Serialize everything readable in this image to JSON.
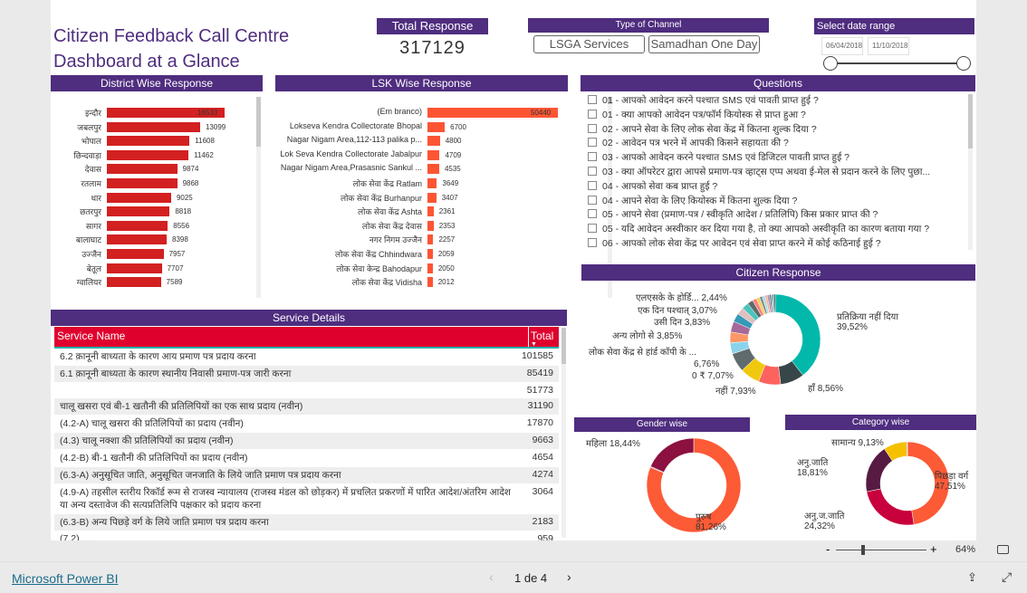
{
  "header": {
    "title_line1": "Citizen Feedback Call Centre",
    "title_line2": "Dashboard at a Glance",
    "total_label": "Total Response",
    "total_value": "317129",
    "channel_label": "Type of Channel",
    "channels": [
      "LSGA Services",
      "Samadhan One Day"
    ],
    "date_label": "Select date range",
    "date_from": "06/04/2018",
    "date_to": "11/10/2018",
    "date_range_fill": 1.0
  },
  "district": {
    "title": "District Wise Response",
    "color": "#d32020",
    "max": 16533,
    "items": [
      {
        "label": "इन्दौर",
        "value": 16533
      },
      {
        "label": "जबलपुर",
        "value": 13099
      },
      {
        "label": "भोपाल",
        "value": 11608
      },
      {
        "label": "छिन्दवाड़ा",
        "value": 11462
      },
      {
        "label": "देवास",
        "value": 9874
      },
      {
        "label": "रतलाम",
        "value": 9868
      },
      {
        "label": "धार",
        "value": 9025
      },
      {
        "label": "छतरपुर",
        "value": 8818
      },
      {
        "label": "सागर",
        "value": 8556
      },
      {
        "label": "बालाघाट",
        "value": 8398
      },
      {
        "label": "उज्जैन",
        "value": 7957
      },
      {
        "label": "बेतूल",
        "value": 7707
      },
      {
        "label": "ग्वालियर",
        "value": 7589
      }
    ]
  },
  "lsk": {
    "title": "LSK Wise Response",
    "color": "#fd5534",
    "max": 50440,
    "items": [
      {
        "label": "(Em branco)",
        "value": 50440
      },
      {
        "label": "Lokseva Kendra Collectorate Bhopal",
        "value": 6700
      },
      {
        "label": "Nagar Nigam Area,112-113 palika p...",
        "value": 4800
      },
      {
        "label": "Lok Seva Kendra Collectorate Jabalpur",
        "value": 4709
      },
      {
        "label": "Nagar Nigam Area,Prasasnic Sankul ...",
        "value": 4535
      },
      {
        "label": "लोक सेवा केंद्र Ratlam",
        "value": 3649
      },
      {
        "label": "लोक सेवा केंद्र Burhanpur",
        "value": 3407
      },
      {
        "label": "लोक सेवा केंद्र Ashta",
        "value": 2361
      },
      {
        "label": "लोक सेवा केंद्र देवास",
        "value": 2353
      },
      {
        "label": "नगर निगम उज्जैन",
        "value": 2257
      },
      {
        "label": "लोक सेवा केंद्र Chhindwara",
        "value": 2059
      },
      {
        "label": "लोक सेवा केन्द्र Bahodapur",
        "value": 2050
      },
      {
        "label": "लोक सेवा केंद्र Vidisha",
        "value": 2012
      }
    ]
  },
  "questions": {
    "title": "Questions",
    "items": [
      "01 - आपको आवेदन करने पश्चात SMS एवं पावती प्राप्त हुई ?",
      "01 - क्या आपको आवेदन पत्र/फॉर्म कियोस्क से प्राप्त हुआ ?",
      "02 - आपने सेवा के लिए लोक सेवा केंद्र में कितना शुल्क दिया ?",
      "02 - आवेदन पत्र भरने में आपकी किसने सहायता की ?",
      "03 - आपको आवेदन करने पश्चात SMS एवं डिजिटल पावती प्राप्त हुई ?",
      "03 - क्या ऑपरेटर द्वारा आपसे प्रमाण-पत्र व्हाट्स एप्प अथवा ई-मेल से प्रदान करने के लिए पुछा...",
      "04 - आपको सेवा कब प्राप्त हुई ?",
      "04 - आपने सेवा के लिए कियोस्क में कितना शुल्क दिया ?",
      "05 - आपने सेवा (प्रमाण-पत्र / स्वीकृति आदेश / प्रतिलिपि) किस प्रकार प्राप्त की ?",
      "05 - यदि आवेदन अस्वीकार कर दिया गया है, तो क्या आपको अस्वीकृति का कारण बताया गया ?",
      "06 - आपको लोक सेवा केंद्र पर आवेदन एवं सेवा प्राप्त करने में कोई कठिनाई हुई ?"
    ]
  },
  "service": {
    "title": "Service Details",
    "col_name": "Service Name",
    "col_total": "Total",
    "header_color": "#e0002e",
    "rows": [
      {
        "name": "6.2 क़ानूनी बाध्यता के कारण आय प्रमाण पत्र प्रदाय करना",
        "total": "101585"
      },
      {
        "name": "6.1 क़ानूनी बाध्यता के कारण स्थानीय निवासी प्रमाण-पत्र जारी करना",
        "total": "85419"
      },
      {
        "name": "",
        "total": "51773"
      },
      {
        "name": "चालू खसरा एवं बी-1 खतौनी की प्रतिलिपियों का एक साथ प्रदाय (नवीन)",
        "total": "31190"
      },
      {
        "name": "(4.2-A) चालू खसरा की प्रतिलिपियों का प्रदाय (नवीन)",
        "total": "17870"
      },
      {
        "name": "(4.3) चालू नक्शा की प्रतिलिपियों का प्रदाय (नवीन)",
        "total": "9663"
      },
      {
        "name": "(4.2-B) बी-1 खतौनी की प्रतिलिपियों का प्रदाय (नवीन)",
        "total": "4654"
      },
      {
        "name": "(6.3-A) अनुसूचित जाति, अनुसूचित जनजाति के लिये जाति प्रमाण पत्र प्रदाय करना",
        "total": "4274"
      },
      {
        "name": "(4.9-A) तहसील स्तरीय रिकॉर्ड रूम से राजस्व न्यायालय (राजस्व मंडल को छोड़कर) में प्रचलित प्रकरणों में पारित आदेश/अंतरिम आदेश या अन्य दस्तावेज की सत्यप्रतिलिपि पक्षकार को प्रदाय करना",
        "total": "3064"
      },
      {
        "name": "(6.3-B) अन्य पिछड़े वर्ग के लिये जाति प्रमाण पत्र प्रदाय करना",
        "total": "2183"
      },
      {
        "name": "(7.2) ...",
        "total": "959"
      }
    ]
  },
  "chart_data": [
    {
      "type": "pie",
      "title": "Citizen Response",
      "slices": [
        {
          "label": "प्रतिक्रिया नहीं दिया",
          "value": 39.52,
          "color": "#01b8aa"
        },
        {
          "label": "हाँ",
          "value": 8.56,
          "color": "#374649"
        },
        {
          "label": "नहीं",
          "value": 7.93,
          "color": "#fd625e"
        },
        {
          "label": "0 ₹",
          "value": 7.07,
          "color": "#f2c80f"
        },
        {
          "label": "लोक सेवा केंद्र से हांर्ड कॉपी के ...",
          "value": 6.76,
          "color": "#5f6b6d"
        },
        {
          "label": "",
          "value": 4.0,
          "color": "#8ad4eb"
        },
        {
          "label": "अन्य लोगो से",
          "value": 3.85,
          "color": "#fe9666"
        },
        {
          "label": "उसी दिन",
          "value": 3.83,
          "color": "#a66999"
        },
        {
          "label": "एक दिन पश्चात्",
          "value": 3.07,
          "color": "#3599b8"
        },
        {
          "label": "",
          "value": 2.6,
          "color": "#dfbfbf"
        },
        {
          "label": "एलएसके के होर्डि...",
          "value": 2.44,
          "color": "#4ac5bb"
        },
        {
          "label": "",
          "value": 2.0,
          "color": "#5f6b6d"
        },
        {
          "label": "",
          "value": 1.5,
          "color": "#fb8281"
        },
        {
          "label": "",
          "value": 1.2,
          "color": "#f4d25a"
        },
        {
          "label": "",
          "value": 1.0,
          "color": "#7f898a"
        },
        {
          "label": "",
          "value": 1.0,
          "color": "#a4ddee"
        },
        {
          "label": "",
          "value": 0.8,
          "color": "#fdab89"
        },
        {
          "label": "",
          "value": 0.8,
          "color": "#b687ac"
        },
        {
          "label": "",
          "value": 0.6,
          "color": "#28738a"
        },
        {
          "label": "",
          "value": 0.5,
          "color": "#a78f8f"
        },
        {
          "label": "",
          "value": 0.5,
          "color": "#168980"
        },
        {
          "label": "",
          "value": 0.47,
          "color": "#293537"
        }
      ]
    },
    {
      "type": "pie",
      "title": "Gender wise",
      "slices": [
        {
          "label": "पुरुष",
          "value": 81.26,
          "color": "#fd5a36"
        },
        {
          "label": "",
          "value": 0.3,
          "color": "#999999"
        },
        {
          "label": "महिला",
          "value": 18.44,
          "color": "#8c1040"
        }
      ]
    },
    {
      "type": "pie",
      "title": "Category wise",
      "slices": [
        {
          "label": "पिछड़ा वर्ग",
          "value": 47.51,
          "color": "#fd5a36"
        },
        {
          "label": "अनु.ज.जाति",
          "value": 24.32,
          "color": "#c8003c"
        },
        {
          "label": "अनु.जाति",
          "value": 18.81,
          "color": "#561a43"
        },
        {
          "label": "सामान्य",
          "value": 9.13,
          "color": "#f5c000"
        },
        {
          "label": "",
          "value": 0.23,
          "color": "#3599b8"
        }
      ]
    }
  ],
  "pct": {
    "c0": "39,52%",
    "c1": "8,56%",
    "c2": "7,93%",
    "c3": "7,07%",
    "c4": "6,76%",
    "c6": "3,85%",
    "c7": "3,83%",
    "c8": "3,07%",
    "c10": "2,44%",
    "g0": "81,26%",
    "g2": "18,44%",
    "k0": "47,51%",
    "k1": "24,32%",
    "k2": "18,81%",
    "k3": "9,13%"
  },
  "zoom": {
    "minus": "-",
    "plus": "+",
    "level": "64%",
    "value_fraction": 0.3
  },
  "footer": {
    "brand": "Microsoft Power BI",
    "page": "1 de 4"
  }
}
